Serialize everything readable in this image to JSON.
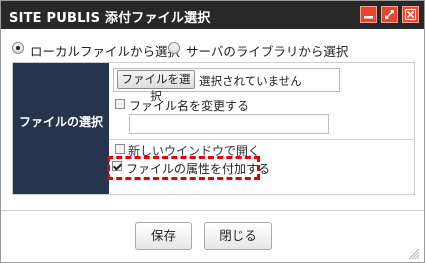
{
  "dialog": {
    "title": "SITE PUBLIS 添付ファイル選択",
    "controls": [
      "minimize-icon",
      "maximize-icon",
      "close-icon"
    ],
    "accent_color": "#e8442f"
  },
  "source": {
    "local_label": "ローカルファイルから選択",
    "server_label": "サーバのライブラリから選択",
    "selected": "local"
  },
  "form": {
    "header_label": "ファイルの選択",
    "choose_file_label": "ファイルを選択",
    "no_file_label": "選択されていません",
    "rename_label": "ファイル名を変更する",
    "rename_value": "",
    "rename_checked": false,
    "new_window_label": "新しいウインドウで開く",
    "new_window_checked": false,
    "attribute_label": "ファイルの属性を付加する",
    "attribute_checked": true
  },
  "buttons": {
    "save_label": "保存",
    "close_label": "閉じる"
  }
}
